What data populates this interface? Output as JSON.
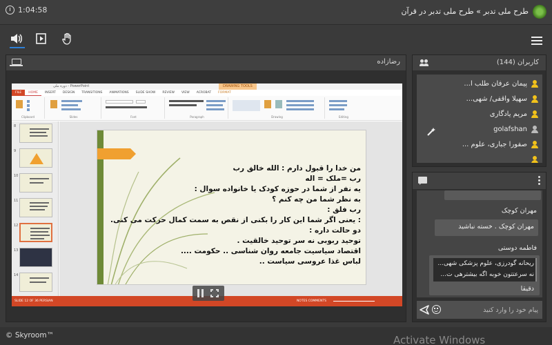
{
  "topbar": {
    "timer": "1:04:58",
    "title": "طرح ملی تدبر » طرح ملی تدبر در قرآن"
  },
  "toolbar": {
    "icons": [
      "speaker-icon",
      "play-icon",
      "hand-icon",
      "menu-icon"
    ]
  },
  "stage": {
    "presenter": "رضازاده",
    "ppt": {
      "window_title": "دوره ملی - PowerPoint",
      "drawing_tools": "DRAWING TOOLS",
      "tabs": [
        "FILE",
        "HOME",
        "INSERT",
        "DESIGN",
        "TRANSITIONS",
        "ANIMATIONS",
        "SLIDE SHOW",
        "REVIEW",
        "VIEW",
        "ACROBAT",
        "FORMAT"
      ],
      "ribbon_groups": [
        "Clipboard",
        "Slides",
        "Font",
        "Paragraph",
        "Drawing",
        "Editing"
      ],
      "thumb_numbers": [
        "8",
        "9",
        "10",
        "11",
        "12",
        "13",
        "14"
      ],
      "slide_lines": [
        "من خدا را قبول دارم :  الله  خالق  رب",
        "رب   =ملک = اله",
        "یه نفر از شما در حوزه کودک یا خانواده سوال :",
        "به نظر شما من چه کنم ؟",
        "رب فلق :",
        ": یعنی اگر شما این کار را بکنی از نقص به سمت کمال حرکت می کنی.",
        "دو حالت داره :",
        "توحید ربوبی نه سر توحید خالقیت .",
        "اقتصاد سیاسیت جامعه روان شناسی .. حکومت ....",
        "لباس  غذا  عروسی  سیاست .."
      ],
      "status_left": "SLIDE 12 OF 36    PERSIAN",
      "status_right": "NOTES   COMMENTS"
    }
  },
  "users": {
    "title": "کاربران (144)",
    "list": [
      {
        "name": "پیمان عرفان طلب ا..."
      },
      {
        "name": "سهیلا واقفی/ شهی..."
      },
      {
        "name": "مریم یادگاری"
      },
      {
        "name": "golafshan"
      },
      {
        "name": "صفورا جباری، علوم ..."
      }
    ]
  },
  "chat": {
    "messages": [
      {
        "sender": "مهران کوچک",
        "text": "مهران کوچک . خسته نباشید"
      },
      {
        "sender": "فاطمه دوستی",
        "quote": [
          "ریحانه گودرزی، علوم پزشکی شهی...",
          "نه سرعتتون خوبه اگه بیشترهی ت..."
        ],
        "text": "دقیقا"
      }
    ],
    "input_placeholder": "پیام خود را وارد کنید"
  },
  "footer": {
    "brand": "© Skyroom™",
    "watermark": "Activate Windows"
  }
}
